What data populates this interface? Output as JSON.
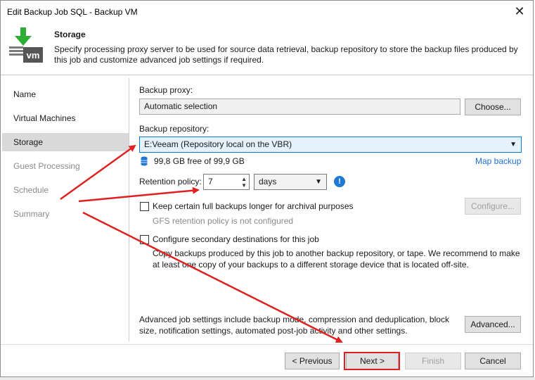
{
  "window": {
    "title": "Edit Backup Job SQL - Backup VM",
    "close_glyph": "✕"
  },
  "header": {
    "title": "Storage",
    "description": "Specify processing proxy server to be used for source data retrieval, backup repository to store the backup files produced by this job and customize advanced job settings if required.",
    "icon_text": "vm"
  },
  "nav": {
    "items": [
      {
        "label": "Name",
        "state": "normal"
      },
      {
        "label": "Virtual Machines",
        "state": "normal"
      },
      {
        "label": "Storage",
        "state": "active"
      },
      {
        "label": "Guest Processing",
        "state": "disabled"
      },
      {
        "label": "Schedule",
        "state": "disabled"
      },
      {
        "label": "Summary",
        "state": "disabled"
      }
    ]
  },
  "proxy": {
    "label": "Backup proxy:",
    "value": "Automatic selection",
    "choose_label": "Choose..."
  },
  "repository": {
    "label": "Backup repository:",
    "value": "E:Veeam (Repository local on the VBR)",
    "free_space": "99,8 GB free of 99,9 GB",
    "map_backup": "Map backup"
  },
  "retention": {
    "label": "Retention policy:",
    "value": "7",
    "unit": "days"
  },
  "archival": {
    "label": "Keep certain full backups longer for archival purposes",
    "gfs_text": "GFS retention policy is not configured",
    "configure_label": "Configure..."
  },
  "secondary": {
    "label": "Configure secondary destinations for this job",
    "description": "Copy backups produced by this job to another backup repository, or tape. We recommend to make at least one copy of your backups to a different storage device that is located off-site."
  },
  "advanced": {
    "description": "Advanced job settings include backup mode, compression and deduplication, block size, notification settings, automated post-job activity and other settings.",
    "button_label": "Advanced..."
  },
  "footer": {
    "previous": "< Previous",
    "next": "Next >",
    "finish": "Finish",
    "cancel": "Cancel"
  },
  "colors": {
    "accent": "#0078d7",
    "link": "#1f6fcf",
    "annotation": "#e02020",
    "icon_green": "#2fae35"
  }
}
